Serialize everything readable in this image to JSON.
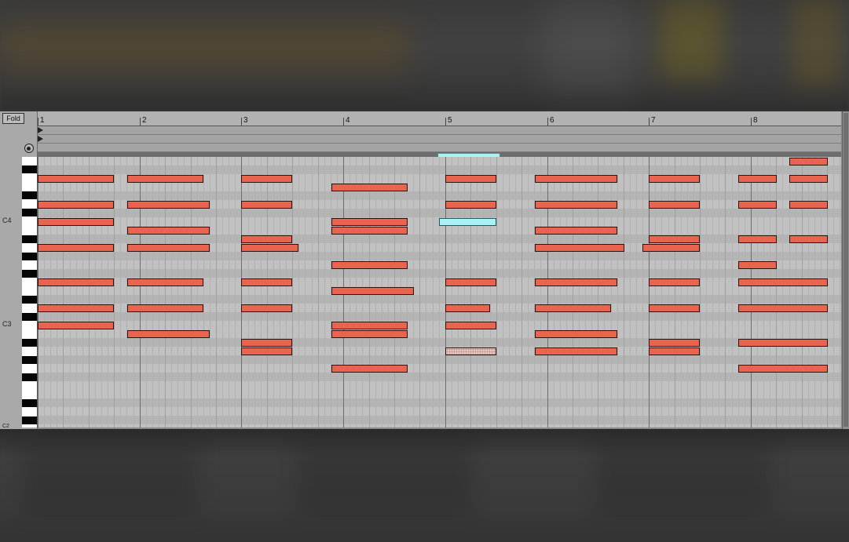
{
  "toolbar": {
    "fold_label": "Fold"
  },
  "icons": {
    "audition": "headphones-icon",
    "lane_toggle": "triangle-right-icon"
  },
  "ruler": {
    "bars": [
      "1",
      "2",
      "3",
      "4",
      "5",
      "6",
      "7",
      "8"
    ]
  },
  "piano": {
    "labels": [
      "C4",
      "C3",
      "C2"
    ]
  },
  "colors": {
    "note": "#e8644e",
    "selected_note": "#a8f2f6",
    "grid": "#c1c1c1"
  },
  "notes": [
    {
      "row": 2,
      "start": 0.0,
      "len": 0.75
    },
    {
      "row": 2,
      "start": 0.88,
      "len": 0.75
    },
    {
      "row": 2,
      "start": 2.0,
      "len": 0.5
    },
    {
      "row": 2,
      "start": 4.0,
      "len": 0.5
    },
    {
      "row": 2,
      "start": 4.88,
      "len": 0.81
    },
    {
      "row": 2,
      "start": 6.0,
      "len": 0.5
    },
    {
      "row": 2,
      "start": 6.88,
      "len": 0.38
    },
    {
      "row": 2,
      "start": 7.38,
      "len": 0.38
    },
    {
      "row": 0,
      "start": 7.38,
      "len": 0.38
    },
    {
      "row": 3,
      "start": 2.88,
      "len": 0.75
    },
    {
      "row": 5,
      "start": 0.0,
      "len": 0.75
    },
    {
      "row": 5,
      "start": 0.88,
      "len": 0.81
    },
    {
      "row": 5,
      "start": 2.0,
      "len": 0.5
    },
    {
      "row": 5,
      "start": 4.0,
      "len": 0.5
    },
    {
      "row": 5,
      "start": 4.88,
      "len": 0.81
    },
    {
      "row": 5,
      "start": 6.0,
      "len": 0.5
    },
    {
      "row": 5,
      "start": 6.88,
      "len": 0.38
    },
    {
      "row": 5,
      "start": 7.38,
      "len": 0.38
    },
    {
      "row": 7,
      "start": 0.0,
      "len": 0.75
    },
    {
      "row": 7,
      "start": 2.88,
      "len": 0.75
    },
    {
      "row": 7,
      "start": 4.0,
      "len": 0.5
    },
    {
      "row": 8,
      "start": 0.88,
      "len": 0.81
    },
    {
      "row": 8,
      "start": 2.88,
      "len": 0.75
    },
    {
      "row": 8,
      "start": 4.88,
      "len": 0.81
    },
    {
      "row": 9,
      "start": 2.0,
      "len": 0.5
    },
    {
      "row": 9,
      "start": 6.0,
      "len": 0.5
    },
    {
      "row": 9,
      "start": 6.88,
      "len": 0.38
    },
    {
      "row": 9,
      "start": 7.38,
      "len": 0.38
    },
    {
      "row": 10,
      "start": 0.0,
      "len": 0.75
    },
    {
      "row": 10,
      "start": 0.88,
      "len": 0.81
    },
    {
      "row": 10,
      "start": 2.0,
      "len": 0.56
    },
    {
      "row": 10,
      "start": 4.88,
      "len": 0.88
    },
    {
      "row": 10,
      "start": 5.94,
      "len": 0.56
    },
    {
      "row": 12,
      "start": 2.88,
      "len": 0.75
    },
    {
      "row": 12,
      "start": 6.88,
      "len": 0.38
    },
    {
      "row": 14,
      "start": 0.0,
      "len": 0.75
    },
    {
      "row": 14,
      "start": 0.88,
      "len": 0.75
    },
    {
      "row": 14,
      "start": 2.0,
      "len": 0.5
    },
    {
      "row": 14,
      "start": 4.0,
      "len": 0.5
    },
    {
      "row": 14,
      "start": 4.88,
      "len": 0.81
    },
    {
      "row": 14,
      "start": 6.0,
      "len": 0.5
    },
    {
      "row": 14,
      "start": 6.88,
      "len": 0.88
    },
    {
      "row": 15,
      "start": 2.88,
      "len": 0.81
    },
    {
      "row": 17,
      "start": 0.0,
      "len": 0.75
    },
    {
      "row": 17,
      "start": 0.88,
      "len": 0.75
    },
    {
      "row": 17,
      "start": 2.0,
      "len": 0.5
    },
    {
      "row": 17,
      "start": 4.0,
      "len": 0.44
    },
    {
      "row": 17,
      "start": 4.88,
      "len": 0.75
    },
    {
      "row": 17,
      "start": 6.0,
      "len": 0.5
    },
    {
      "row": 17,
      "start": 6.88,
      "len": 0.88
    },
    {
      "row": 19,
      "start": 0.0,
      "len": 0.75
    },
    {
      "row": 19,
      "start": 2.88,
      "len": 0.75
    },
    {
      "row": 19,
      "start": 4.0,
      "len": 0.5
    },
    {
      "row": 20,
      "start": 0.88,
      "len": 0.81
    },
    {
      "row": 20,
      "start": 2.88,
      "len": 0.75
    },
    {
      "row": 20,
      "start": 4.88,
      "len": 0.81
    },
    {
      "row": 21,
      "start": 2.0,
      "len": 0.5
    },
    {
      "row": 21,
      "start": 6.0,
      "len": 0.5
    },
    {
      "row": 21,
      "start": 6.88,
      "len": 0.88
    },
    {
      "row": 22,
      "start": 2.0,
      "len": 0.5
    },
    {
      "row": 22,
      "start": 4.88,
      "len": 0.81
    },
    {
      "row": 22,
      "start": 6.0,
      "len": 0.5
    },
    {
      "row": 24,
      "start": 2.88,
      "len": 0.75
    },
    {
      "row": 24,
      "start": 6.88,
      "len": 0.88
    }
  ],
  "selected_note": {
    "row": 7,
    "start": 3.94,
    "len": 0.56
  },
  "muted_note": {
    "row": 22,
    "start": 4.0,
    "len": 0.5
  }
}
